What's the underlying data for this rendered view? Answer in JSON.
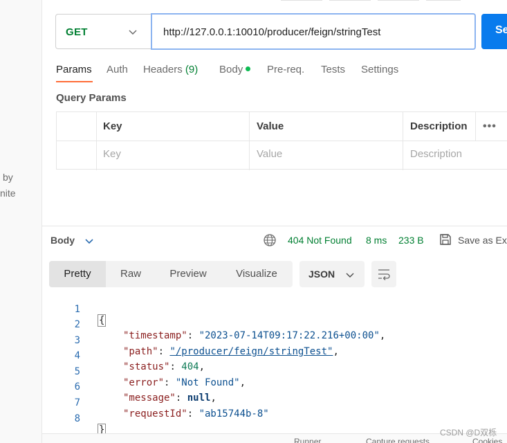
{
  "sidebar": {
    "line1": "by",
    "line2": "nite"
  },
  "request": {
    "method": "GET",
    "url": "http://127.0.0.1:10010/producer/feign/stringTest",
    "send_label": "Se"
  },
  "tabs": [
    {
      "label": "Params",
      "active": true
    },
    {
      "label": "Auth"
    },
    {
      "label": "Headers",
      "count": "(9)"
    },
    {
      "label": "Body",
      "dot": true
    },
    {
      "label": "Pre-req."
    },
    {
      "label": "Tests"
    },
    {
      "label": "Settings"
    }
  ],
  "query_params": {
    "title": "Query Params",
    "headers": [
      "Key",
      "Value",
      "Description"
    ],
    "placeholders": [
      "Key",
      "Value",
      "Description"
    ]
  },
  "response": {
    "label": "Body",
    "status": "404 Not Found",
    "time": "8 ms",
    "size": "233 B",
    "save_label": "Save as Ex",
    "views": [
      "Pretty",
      "Raw",
      "Preview",
      "Visualize"
    ],
    "format": "JSON",
    "colors": {
      "status": "#007f31",
      "accent": "#ff6c37",
      "send": "#097bed"
    }
  },
  "code": {
    "line_numbers": [
      "1",
      "2",
      "3",
      "4",
      "5",
      "6",
      "7",
      "8"
    ],
    "open_brace": "{",
    "close_brace": "}",
    "entries": [
      {
        "key": "\"timestamp\"",
        "value": "\"2023-07-14T09:17:22.216+00:00\"",
        "sep": ","
      },
      {
        "key": "\"path\"",
        "value": "\"/producer/feign/stringTest\"",
        "sep": ","
      },
      {
        "key": "\"status\"",
        "value": "404",
        "sep": ","
      },
      {
        "key": "\"error\"",
        "value": "\"Not Found\"",
        "sep": ","
      },
      {
        "key": "\"message\"",
        "value": "null",
        "sep": ","
      },
      {
        "key": "\"requestId\"",
        "value": "\"ab15744b-8\"",
        "sep": ""
      }
    ]
  },
  "footer": {
    "runner": "Runner",
    "capture": "Capture requests",
    "cookies": "Cookies"
  },
  "watermark": "CSDN @D双栎"
}
